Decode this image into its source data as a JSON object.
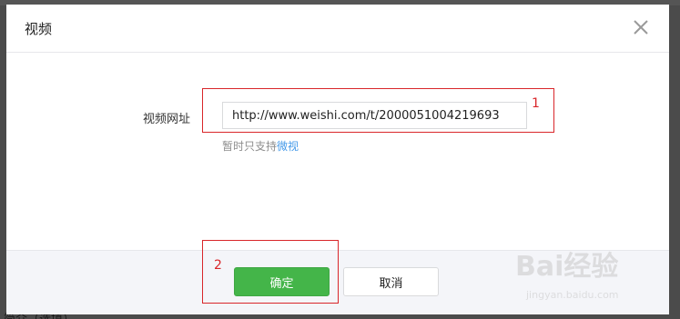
{
  "dialog": {
    "title": "视频"
  },
  "form": {
    "url_label": "视频网址",
    "url_value": "http://www.weishi.com/t/2000051004219693",
    "hint_prefix": "暂时只支持",
    "hint_link": "微视"
  },
  "annotations": {
    "step1": "1",
    "step2": "2"
  },
  "footer": {
    "confirm_label": "确定",
    "cancel_label": "取消"
  },
  "background": {
    "partial_text": "简介（选填）"
  },
  "watermark": {
    "brand": "Bai经验",
    "url": "jingyan.baidu.com"
  },
  "colors": {
    "primary_green": "#44b549",
    "link_blue": "#459ae9",
    "annotation_red": "#d9262a"
  }
}
